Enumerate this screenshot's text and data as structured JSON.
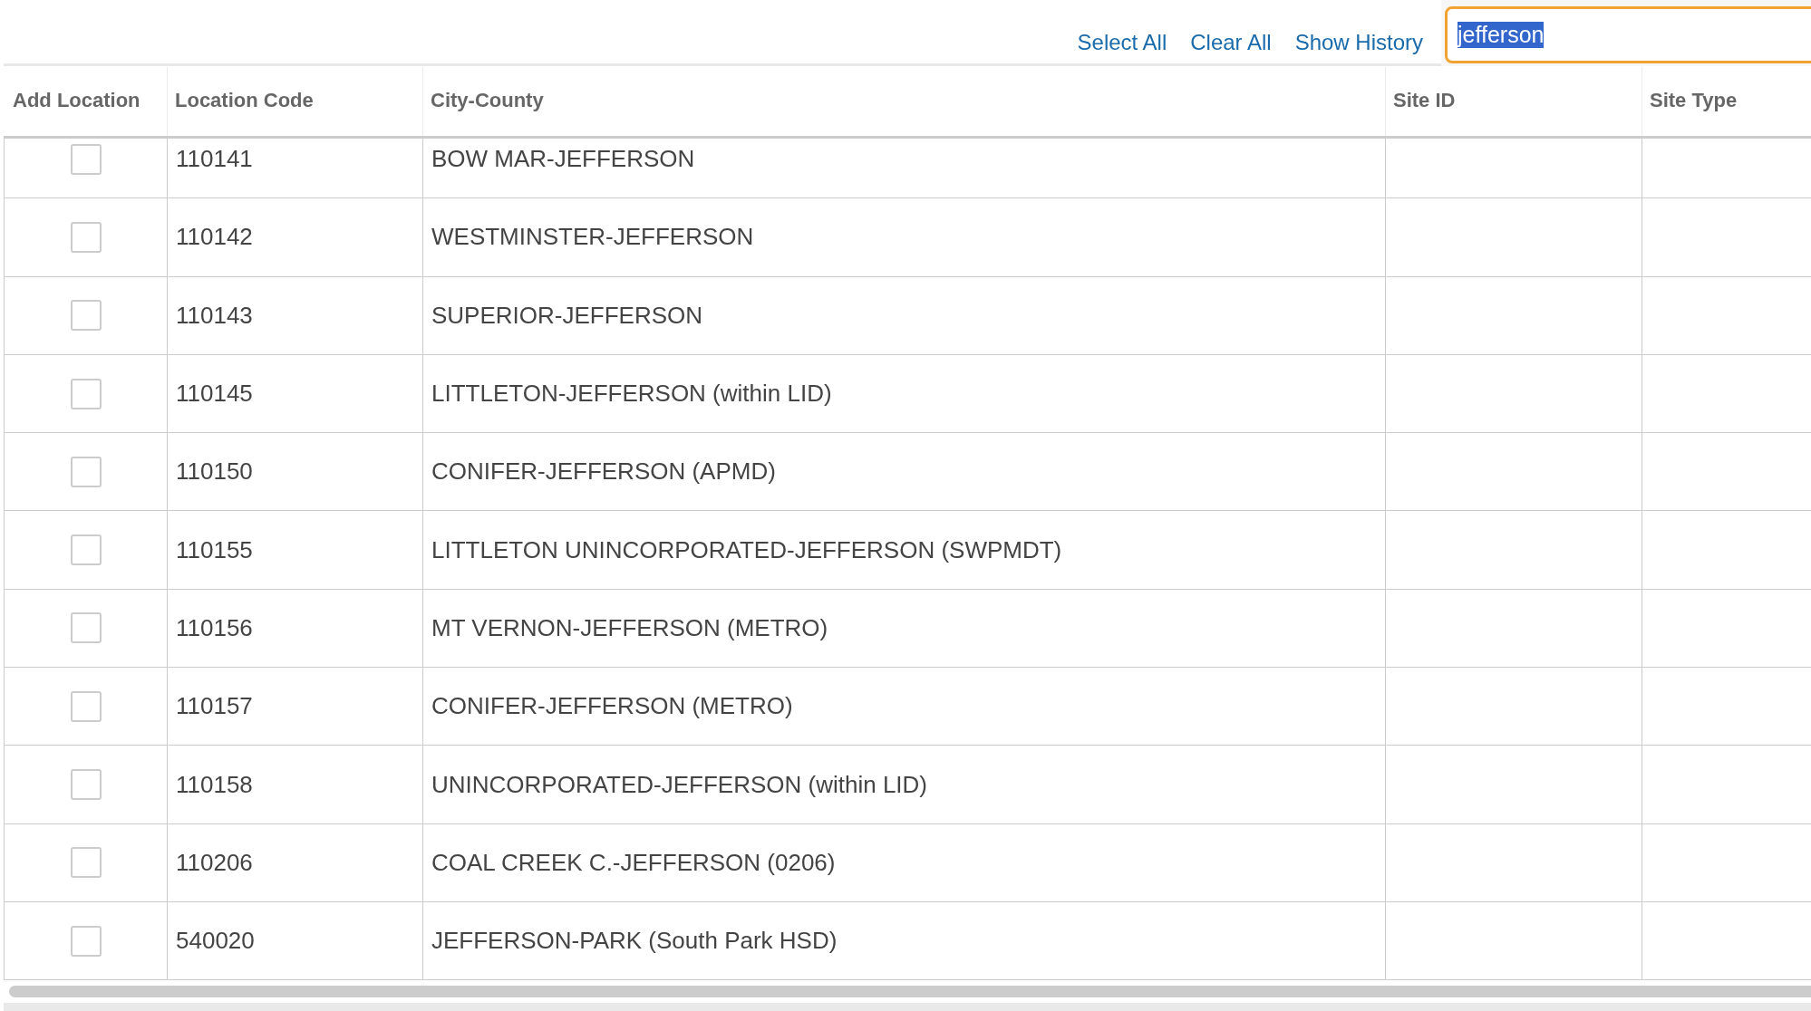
{
  "toolbar": {
    "links": [
      "Select All",
      "Clear All",
      "Show History"
    ],
    "search": {
      "value": "jefferson",
      "focused": true,
      "text_selected": true
    }
  },
  "table": {
    "columns": [
      "Add Location",
      "Location Code",
      "City-County",
      "Site ID",
      "Site Type"
    ],
    "rows": [
      {
        "checked": false,
        "location_code": "110141",
        "city_county": "BOW MAR-JEFFERSON"
      },
      {
        "checked": false,
        "location_code": "110142",
        "city_county": "WESTMINSTER-JEFFERSON"
      },
      {
        "checked": false,
        "location_code": "110143",
        "city_county": "SUPERIOR-JEFFERSON"
      },
      {
        "checked": false,
        "location_code": "110145",
        "city_county": "LITTLETON-JEFFERSON (within LID)"
      },
      {
        "checked": false,
        "location_code": "110150",
        "city_county": "CONIFER-JEFFERSON (APMD)"
      },
      {
        "checked": false,
        "location_code": "110155",
        "city_county": "LITTLETON UNINCORPORATED-JEFFERSON (SWPMDT)"
      },
      {
        "checked": false,
        "location_code": "110156",
        "city_county": "MT VERNON-JEFFERSON (METRO)"
      },
      {
        "checked": false,
        "location_code": "110157",
        "city_county": "CONIFER-JEFFERSON (METRO)"
      },
      {
        "checked": false,
        "location_code": "110158",
        "city_county": "UNINCORPORATED-JEFFERSON (within LID)"
      },
      {
        "checked": false,
        "location_code": "110206",
        "city_county": "COAL CREEK C.-JEFFERSON (0206)"
      },
      {
        "checked": false,
        "location_code": "540020",
        "city_county": "JEFFERSON-PARK (South Park HSD)"
      }
    ]
  }
}
